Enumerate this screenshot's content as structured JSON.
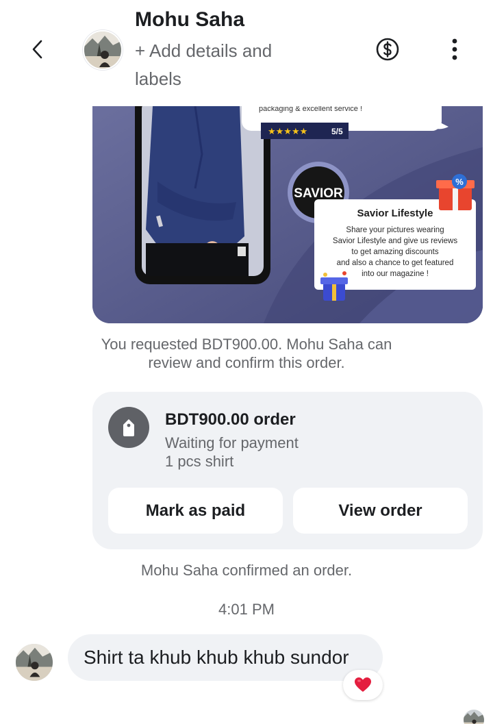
{
  "header": {
    "back_icon": "chevron-left-icon",
    "contact_name": "Mohu Saha",
    "add_details": "+ Add details and labels",
    "money_icon": "dollar-circle-icon",
    "more_icon": "more-vertical-icon"
  },
  "product_image": {
    "review_text": "packaging & excellent service !",
    "rating": "5/5",
    "brand_logo": "SAVIOR",
    "brand_title": "Savior Lifestyle",
    "promo_lines": [
      "Share your pictures wearing",
      "Savior Lifestyle and give us reviews",
      "to get amazing discounts",
      "and also a chance to get featured",
      "into our magazine !"
    ],
    "gift_badge": "%"
  },
  "order_request_note": {
    "line1": "You requested BDT900.00. Mohu Saha can",
    "line2": "review and confirm this order."
  },
  "order_card": {
    "icon": "tag-icon",
    "title": "BDT900.00 order",
    "status": "Waiting for payment",
    "items": "1 pcs shirt",
    "mark_paid_label": "Mark as paid",
    "view_order_label": "View order"
  },
  "confirmation_note": "Mohu Saha confirmed an order.",
  "timestamp": "4:01 PM",
  "message": {
    "text": "Shirt ta khub khub khub sundor",
    "reaction": "heart-icon"
  },
  "colors": {
    "secondary_text": "#65676b",
    "bubble_bg": "#f0f2f5",
    "reaction_red": "#e41e3f"
  }
}
